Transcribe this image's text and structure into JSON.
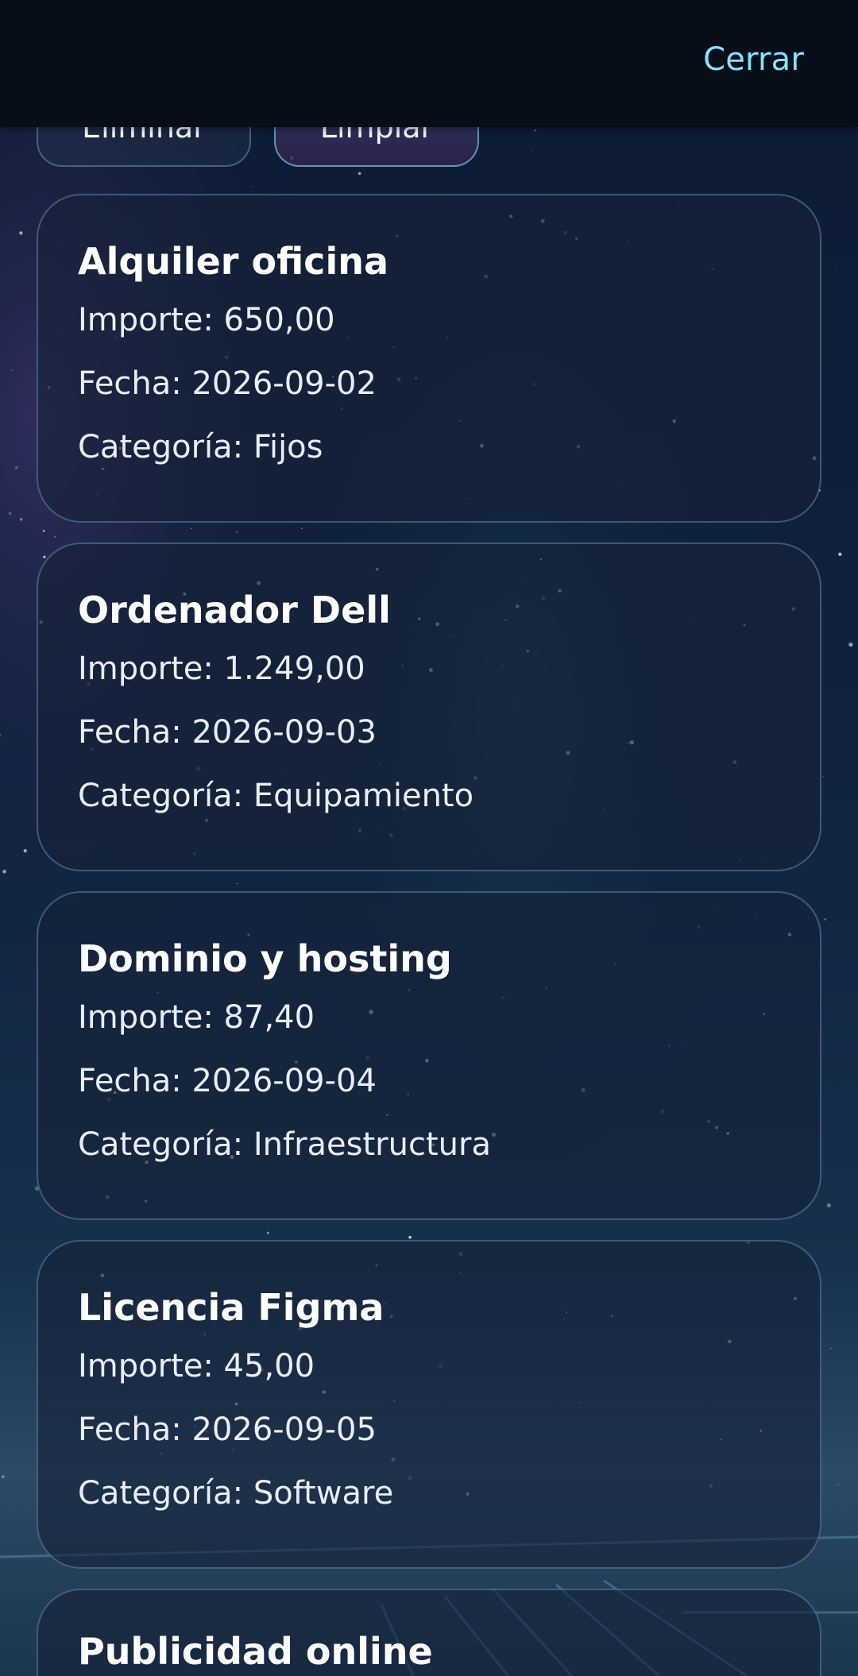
{
  "header": {
    "close_label": "Cerrar"
  },
  "top_buttons": [
    {
      "label": "Eliminar"
    },
    {
      "label": "Limpiar"
    }
  ],
  "expenses": [
    {
      "title": "Alquiler oficina",
      "importe": "Importe: 650,00",
      "fecha": "Fecha: 2026-09-02",
      "categoria": "Categoría: Fijos"
    },
    {
      "title": "Ordenador Dell",
      "importe": "Importe: 1.249,00",
      "fecha": "Fecha: 2026-09-03",
      "categoria": "Categoría: Equipamiento"
    },
    {
      "title": "Dominio y hosting",
      "importe": "Importe: 87,40",
      "fecha": "Fecha: 2026-09-04",
      "categoria": "Categoría: Infraestructura"
    },
    {
      "title": "Licencia Figma",
      "importe": "Importe: 45,00",
      "fecha": "Fecha: 2026-09-05",
      "categoria": "Categoría: Software"
    },
    {
      "title": "Publicidad online",
      "importe": "",
      "fecha": "",
      "categoria": ""
    }
  ],
  "colors": {
    "accent": "#86e1ff",
    "header_bg": "#070e1a",
    "card_border": "#6ea0be"
  }
}
